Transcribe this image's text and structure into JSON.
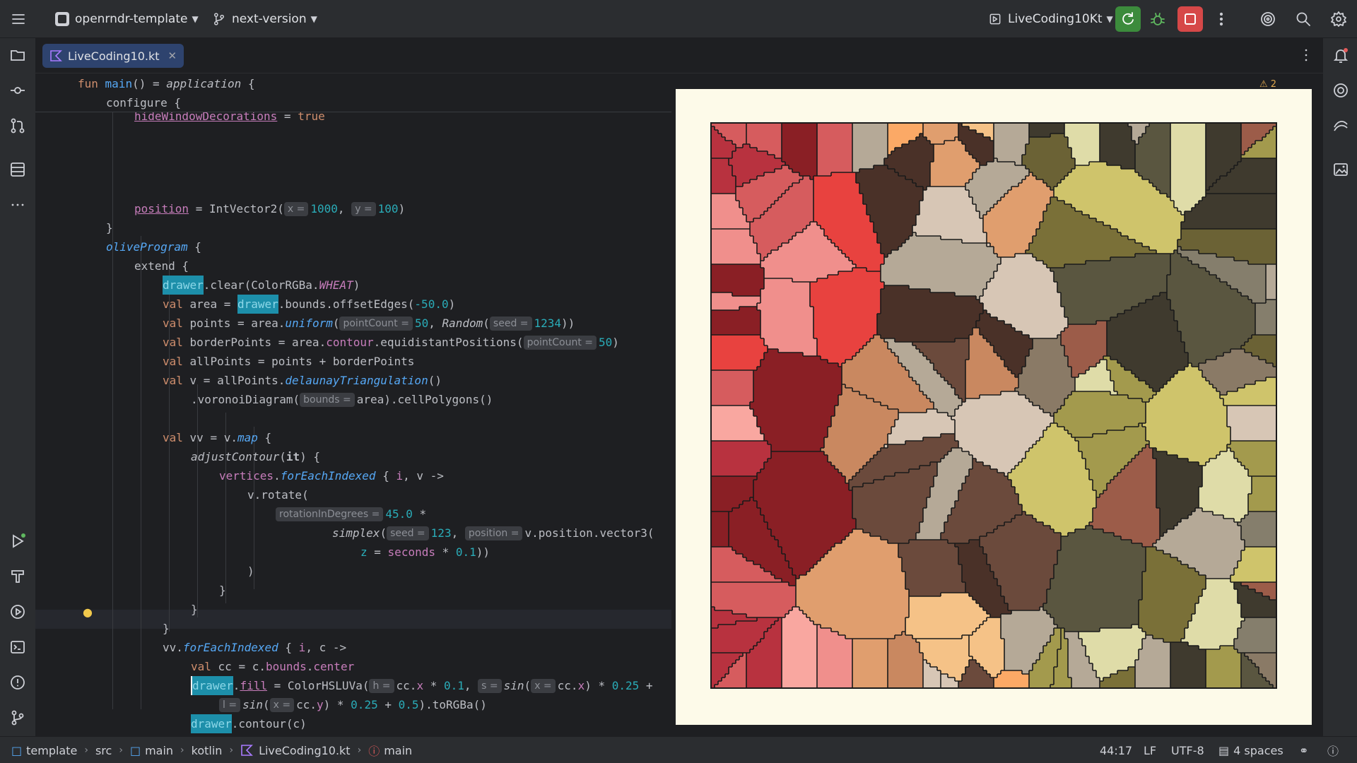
{
  "topbar": {
    "project_name": "openrndr-template",
    "branch_name": "next-version",
    "run_config": "LiveCoding10Kt"
  },
  "tab": {
    "file_name": "LiveCoding10.kt",
    "warning_count": "2"
  },
  "code": {
    "sticky1": {
      "fun": "fun",
      "main": "main",
      "rest": "() = ",
      "application": "application",
      "brace": " {"
    },
    "sticky2": {
      "text": "configure {"
    },
    "l_hide": {
      "prop": "hideWindowDecorations",
      "rest": " = ",
      "val": "true"
    },
    "l_pos": {
      "prop": "position",
      "rest": " = IntVector2(",
      "h1": "x =",
      "n1": "1000",
      "sep": ", ",
      "h2": "y =",
      "n2": "100",
      "close": ")"
    },
    "l_close1": {
      "text": "}"
    },
    "l_olive": {
      "fn": "oliveProgram",
      "rest": " {"
    },
    "l_extend": {
      "text": "extend {"
    },
    "l_clear": {
      "drawer": "drawer",
      "rest": ".clear(ColorRGBa.",
      "prop": "WHEAT",
      "close": ")"
    },
    "l_area": {
      "kw": "val",
      "a": " area = ",
      "drawer": "drawer",
      "b": ".bounds.offsetEdges(",
      "n": "-50.0",
      "c": ")"
    },
    "l_points": {
      "kw": "val",
      "a": " points = area.",
      "fn": "uniform",
      "b": "(",
      "h1": "pointCount =",
      "n1": "50",
      "c": ", ",
      "rand": "Random",
      "d": "(",
      "h2": "seed =",
      "n2": "1234",
      "e": "))"
    },
    "l_border": {
      "kw": "val",
      "a": " borderPoints = area.",
      "prop": "contour",
      "b": ".equidistantPositions(",
      "h": "pointCount =",
      "n": "50",
      "c": ")"
    },
    "l_all": {
      "kw": "val",
      "a": " allPoints = points + borderPoints"
    },
    "l_v": {
      "kw": "val",
      "a": " v = allPoints.",
      "fn": "delaunayTriangulation",
      "b": "()"
    },
    "l_vor": {
      "a": ".voronoiDiagram(",
      "h": "bounds =",
      "b": "area).cellPolygons()"
    },
    "l_vv": {
      "kw": "val",
      "a": " vv = v.",
      "fn": "map",
      "b": " {"
    },
    "l_adjust": {
      "fn": "adjustContour",
      "a": "(",
      "it": "it",
      "b": ") {"
    },
    "l_vert": {
      "prop": "vertices",
      "a": ".",
      "fn": "forEachIndexed",
      "b": " { ",
      "i": "i",
      "c": ", v ->"
    },
    "l_rot": {
      "a": "v.rotate("
    },
    "l_deg": {
      "h": "rotationInDegrees =",
      "n": "45.0",
      "a": " *"
    },
    "l_simplex": {
      "fn": "simplex",
      "a": "(",
      "h1": "seed =",
      "n1": "123",
      "b": ", ",
      "h2": "position =",
      "c": "v.position.vector3("
    },
    "l_z": {
      "prop": "z",
      "a": " = ",
      "prop2": "seconds",
      "b": " * ",
      "n": "0.1",
      "c": "))"
    },
    "l_rp": {
      "text": ")"
    },
    "l_cb1": {
      "text": "}"
    },
    "l_cb2": {
      "text": "}"
    },
    "l_cb3": {
      "text": "}"
    },
    "l_fe": {
      "a": "vv.",
      "fn": "forEachIndexed",
      "b": " { ",
      "i": "i",
      "c": ", c ->"
    },
    "l_cc": {
      "kw": "val",
      "a": " cc = c.",
      "prop": "bounds",
      "b": ".",
      "prop2": "center"
    },
    "l_fill": {
      "drawer": "drawer",
      "a": ".",
      "prop": "fill",
      "b": " = ColorHSLUVa(",
      "h1": "h =",
      "c": "cc.",
      "x": "x",
      "d": " * ",
      "n1": "0.1",
      "e": ", ",
      "h2": "s =",
      "sin": "sin",
      "f": "(",
      "h3": "x =",
      "g": "cc.",
      "x2": "x",
      "h": ") * ",
      "n2": "0.25",
      "i": " +"
    },
    "l_l": {
      "h1": "l =",
      "sin": "sin",
      "a": "(",
      "h2": "x =",
      "b": "cc.",
      "y": "y",
      "c": ") * ",
      "n1": "0.25",
      "d": " + ",
      "n2": "0.5",
      "e": ").toRGBa()"
    },
    "l_contour": {
      "drawer": "drawer",
      "a": ".contour(c)"
    },
    "l_cb4": {
      "text": "}"
    },
    "l_cb5": {
      "text": "}"
    },
    "l_cb6": {
      "text": "}"
    },
    "l_cb7": {
      "text": "}"
    }
  },
  "statusbar": {
    "crumbs": [
      "template",
      "src",
      "main",
      "kotlin",
      "LiveCoding10.kt",
      "main"
    ],
    "position": "44:17",
    "line_sep": "LF",
    "encoding": "UTF-8",
    "indent": "4 spaces"
  },
  "preview": {
    "background": "#fdfae9",
    "palette": [
      "#b8323f",
      "#8a1f25",
      "#f08f8c",
      "#f9a7a0",
      "#d65c5e",
      "#e8423f",
      "#6b4a3c",
      "#4a3128",
      "#c98860",
      "#fba966",
      "#f5c287",
      "#e09e6e",
      "#d7c6b5",
      "#b5a997",
      "#8a7a66",
      "#5a5640",
      "#6b6235",
      "#7a7038",
      "#a39a4d",
      "#cfc46b",
      "#dfdca8",
      "#857e6c",
      "#3f3a2e",
      "#9c5c49"
    ]
  }
}
